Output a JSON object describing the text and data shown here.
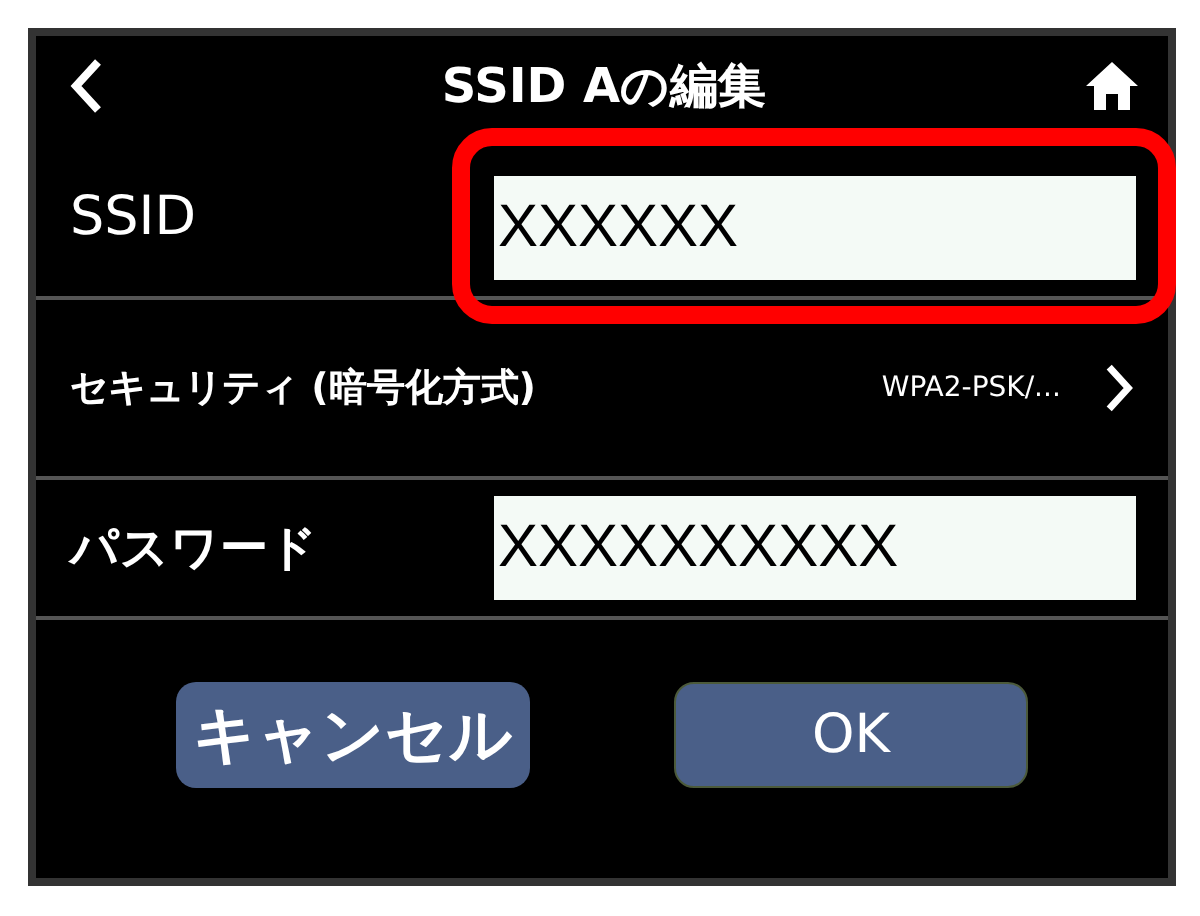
{
  "header": {
    "title": "SSID Aの編集"
  },
  "fields": [
    {
      "label": "SSID",
      "value": "XXXXXX",
      "highlighted": true
    },
    {
      "label": "パスワード",
      "value": "XXXXXXXXXX",
      "highlighted": false
    }
  ],
  "security": {
    "label": "セキュリティ (暗号化方式)",
    "value": "WPA2-PSK/..."
  },
  "buttons": [
    {
      "label": "キャンセル",
      "kind": "cancel"
    },
    {
      "label": "OK",
      "kind": "ok"
    }
  ]
}
